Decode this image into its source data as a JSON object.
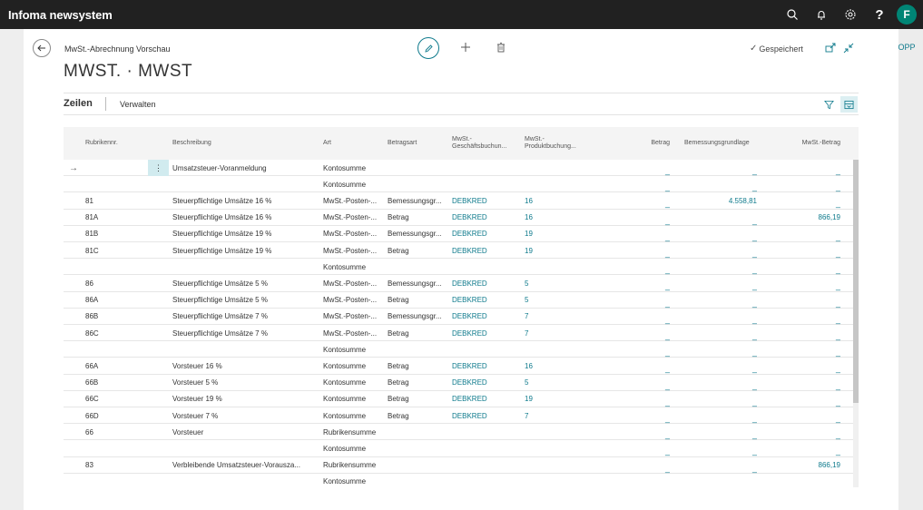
{
  "app": {
    "title": "Infoma newsystem",
    "avatar_letter": "F",
    "help_label": "?"
  },
  "page": {
    "breadcrumb": "MwSt.-Abrechnung Vorschau",
    "title": "MWST. · MWST",
    "saved_label": "Gespeichert",
    "side_label": "DOPP"
  },
  "part": {
    "tab_active": "Zeilen",
    "tab_manage": "Verwalten"
  },
  "grid": {
    "headers": {
      "rubrik": "Rubrikennr.",
      "beschreibung": "Beschreibung",
      "art": "Art",
      "betragsart": "Betragsart",
      "gbg_line1": "MwSt.-",
      "gbg_line2": "Geschäftsbuchun...",
      "pbg_line1": "MwSt.-",
      "pbg_line2": "Produktbuchung...",
      "betrag": "Betrag",
      "bemessung": "Bemessungsgrundlage",
      "mwst_betrag": "MwSt.-Betrag"
    },
    "dash": "_",
    "rows": [
      {
        "rubrik": "",
        "beschreibung": "Umsatzsteuer-Voranmeldung",
        "art": "Kontosumme",
        "betragsart": "",
        "gbg": "",
        "pbg": "",
        "betrag": "_",
        "bemessung": "_",
        "mwst": "_"
      },
      {
        "rubrik": "",
        "beschreibung": "",
        "art": "Kontosumme",
        "betragsart": "",
        "gbg": "",
        "pbg": "",
        "betrag": "_",
        "bemessung": "_",
        "mwst": "_"
      },
      {
        "rubrik": "81",
        "beschreibung": "Steuerpflichtige Umsätze 16 %",
        "art": "MwSt.-Posten-...",
        "betragsart": "Bemessungsgr...",
        "gbg": "DEBKRED",
        "pbg": "16",
        "betrag": "_",
        "bemessung": "4.558,81",
        "mwst": "_"
      },
      {
        "rubrik": "81A",
        "beschreibung": "Steuerpflichtige Umsätze 16 %",
        "art": "MwSt.-Posten-...",
        "betragsart": "Betrag",
        "gbg": "DEBKRED",
        "pbg": "16",
        "betrag": "_",
        "bemessung": "_",
        "mwst": "866,19"
      },
      {
        "rubrik": "81B",
        "beschreibung": "Steuerpflichtige Umsätze 19 %",
        "art": "MwSt.-Posten-...",
        "betragsart": "Bemessungsgr...",
        "gbg": "DEBKRED",
        "pbg": "19",
        "betrag": "_",
        "bemessung": "_",
        "mwst": "_"
      },
      {
        "rubrik": "81C",
        "beschreibung": "Steuerpflichtige Umsätze 19 %",
        "art": "MwSt.-Posten-...",
        "betragsart": "Betrag",
        "gbg": "DEBKRED",
        "pbg": "19",
        "betrag": "_",
        "bemessung": "_",
        "mwst": "_"
      },
      {
        "rubrik": "",
        "beschreibung": "",
        "art": "Kontosumme",
        "betragsart": "",
        "gbg": "",
        "pbg": "",
        "betrag": "_",
        "bemessung": "_",
        "mwst": "_"
      },
      {
        "rubrik": "86",
        "beschreibung": "Steuerpflichtige Umsätze 5 %",
        "art": "MwSt.-Posten-...",
        "betragsart": "Bemessungsgr...",
        "gbg": "DEBKRED",
        "pbg": "5",
        "betrag": "_",
        "bemessung": "_",
        "mwst": "_"
      },
      {
        "rubrik": "86A",
        "beschreibung": "Steuerpflichtige Umsätze 5 %",
        "art": "MwSt.-Posten-...",
        "betragsart": "Betrag",
        "gbg": "DEBKRED",
        "pbg": "5",
        "betrag": "_",
        "bemessung": "_",
        "mwst": "_"
      },
      {
        "rubrik": "86B",
        "beschreibung": "Steuerpflichtige Umsätze 7 %",
        "art": "MwSt.-Posten-...",
        "betragsart": "Bemessungsgr...",
        "gbg": "DEBKRED",
        "pbg": "7",
        "betrag": "_",
        "bemessung": "_",
        "mwst": "_"
      },
      {
        "rubrik": "86C",
        "beschreibung": "Steuerpflichtige Umsätze 7 %",
        "art": "MwSt.-Posten-...",
        "betragsart": "Betrag",
        "gbg": "DEBKRED",
        "pbg": "7",
        "betrag": "_",
        "bemessung": "_",
        "mwst": "_"
      },
      {
        "rubrik": "",
        "beschreibung": "",
        "art": "Kontosumme",
        "betragsart": "",
        "gbg": "",
        "pbg": "",
        "betrag": "_",
        "bemessung": "_",
        "mwst": "_"
      },
      {
        "rubrik": "66A",
        "beschreibung": "Vorsteuer 16 %",
        "art": "Kontosumme",
        "betragsart": "Betrag",
        "gbg": "DEBKRED",
        "pbg": "16",
        "betrag": "_",
        "bemessung": "_",
        "mwst": "_"
      },
      {
        "rubrik": "66B",
        "beschreibung": "Vorsteuer 5 %",
        "art": "Kontosumme",
        "betragsart": "Betrag",
        "gbg": "DEBKRED",
        "pbg": "5",
        "betrag": "_",
        "bemessung": "_",
        "mwst": "_"
      },
      {
        "rubrik": "66C",
        "beschreibung": "Vorsteuer 19 %",
        "art": "Kontosumme",
        "betragsart": "Betrag",
        "gbg": "DEBKRED",
        "pbg": "19",
        "betrag": "_",
        "bemessung": "_",
        "mwst": "_"
      },
      {
        "rubrik": "66D",
        "beschreibung": "Vorsteuer 7 %",
        "art": "Kontosumme",
        "betragsart": "Betrag",
        "gbg": "DEBKRED",
        "pbg": "7",
        "betrag": "_",
        "bemessung": "_",
        "mwst": "_"
      },
      {
        "rubrik": "66",
        "beschreibung": "Vorsteuer",
        "art": "Rubrikensumme",
        "betragsart": "",
        "gbg": "",
        "pbg": "",
        "betrag": "_",
        "bemessung": "_",
        "mwst": "_"
      },
      {
        "rubrik": "",
        "beschreibung": "",
        "art": "Kontosumme",
        "betragsart": "",
        "gbg": "",
        "pbg": "",
        "betrag": "_",
        "bemessung": "_",
        "mwst": "_"
      },
      {
        "rubrik": "83",
        "beschreibung": "Verbleibende Umsatzsteuer-Vorausza...",
        "art": "Rubrikensumme",
        "betragsart": "",
        "gbg": "",
        "pbg": "",
        "betrag": "_",
        "bemessung": "_",
        "mwst": "866,19"
      },
      {
        "rubrik": "",
        "beschreibung": "",
        "art": "Kontosumme",
        "betragsart": "",
        "gbg": "",
        "pbg": "",
        "betrag": "",
        "bemessung": "",
        "mwst": ""
      }
    ]
  },
  "colors": {
    "accent": "#0e7a8c",
    "appbar": "#212121",
    "avatar": "#008575",
    "selected_cell": "#d1ebef"
  },
  "icons": [
    "search-icon",
    "bell-icon",
    "gear-icon",
    "back-arrow-icon",
    "edit-icon",
    "plus-icon",
    "trash-icon",
    "check-icon",
    "popout-icon",
    "collapse-icon",
    "filter-icon",
    "layout-toggle-icon",
    "more-dots-icon",
    "row-arrow-icon"
  ]
}
